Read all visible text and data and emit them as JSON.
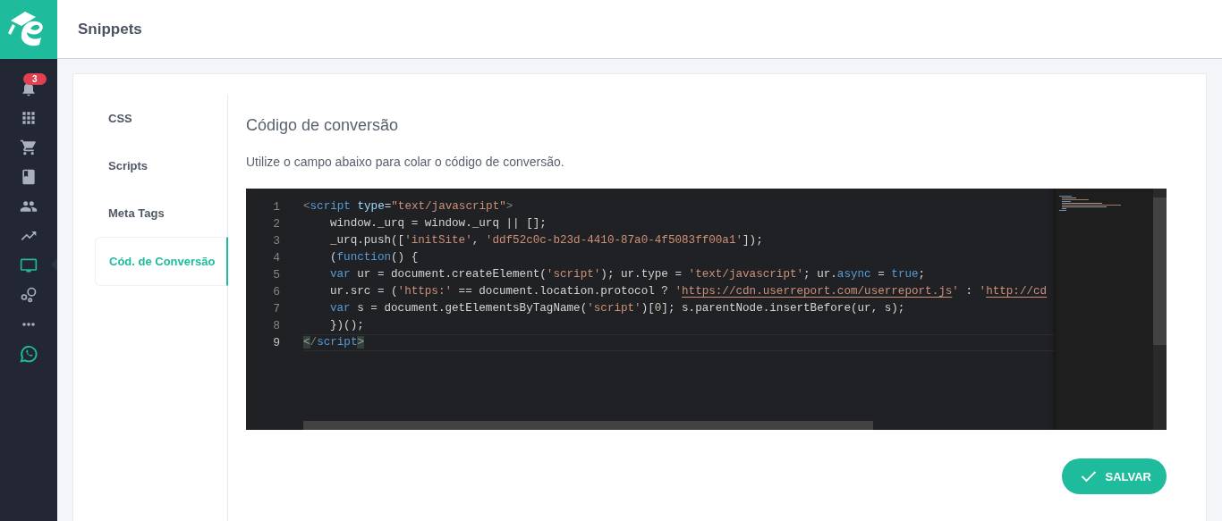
{
  "header": {
    "title": "Snippets"
  },
  "sidebar": {
    "items": [
      {
        "selected": false,
        "badge": "3"
      },
      {
        "selected": false
      },
      {
        "selected": false
      },
      {
        "selected": false
      },
      {
        "selected": false
      },
      {
        "selected": false
      },
      {
        "selected": true
      },
      {
        "selected": false
      },
      {
        "selected": false
      },
      {
        "selected": false
      }
    ]
  },
  "tabs": [
    {
      "label": "CSS",
      "selected": false
    },
    {
      "label": "Scripts",
      "selected": false
    },
    {
      "label": "Meta Tags",
      "selected": false
    },
    {
      "label": "Cód. de Conversão",
      "selected": true
    }
  ],
  "section": {
    "title": "Código de conversão",
    "description": "Utilize o campo abaixo para colar o código de conversão."
  },
  "editor": {
    "lines": [
      {
        "number": "1",
        "indented": false,
        "current": false,
        "tokens": [
          {
            "kind": "punct",
            "text": "<"
          },
          {
            "kind": "tag",
            "text": "script"
          },
          {
            "kind": "attr",
            "text": "type"
          },
          {
            "kind": "plain",
            "text": "="
          },
          {
            "kind": "str",
            "text": "\"text/javascript\""
          },
          {
            "kind": "punct",
            "text": ">"
          }
        ]
      },
      {
        "number": "2",
        "indented": true,
        "current": false,
        "tokens": [
          {
            "kind": "plain",
            "text": "window._urq = window._urq || [];"
          }
        ]
      },
      {
        "number": "3",
        "indented": true,
        "current": false,
        "tokens": [
          {
            "kind": "plain",
            "text": "_urq.push(["
          },
          {
            "kind": "str",
            "text": "'initSite'"
          },
          {
            "kind": "plain",
            "text": ", "
          },
          {
            "kind": "str",
            "text": "'ddf52c0c-b23d-4410-87a0-4f5083ff00a1'"
          },
          {
            "kind": "plain",
            "text": "]);"
          }
        ]
      },
      {
        "number": "4",
        "indented": true,
        "current": false,
        "tokens": [
          {
            "kind": "plain",
            "text": "("
          },
          {
            "kind": "kw",
            "text": "function"
          },
          {
            "kind": "plain",
            "text": "() {"
          }
        ]
      },
      {
        "number": "5",
        "indented": true,
        "current": false,
        "tokens": [
          {
            "kind": "kw",
            "text": "var"
          },
          {
            "kind": "plain",
            "text": " ur = document.createElement("
          },
          {
            "kind": "str",
            "text": "'script'"
          },
          {
            "kind": "plain",
            "text": "); ur.type = "
          },
          {
            "kind": "str",
            "text": "'text/javascript'"
          },
          {
            "kind": "plain",
            "text": "; ur."
          },
          {
            "kind": "kw",
            "text": "async"
          },
          {
            "kind": "plain",
            "text": " = "
          },
          {
            "kind": "kw",
            "text": "true"
          },
          {
            "kind": "plain",
            "text": ";"
          }
        ]
      },
      {
        "number": "6",
        "indented": true,
        "current": false,
        "tokens": [
          {
            "kind": "plain",
            "text": "ur.src = ("
          },
          {
            "kind": "str",
            "text": "'https:'"
          },
          {
            "kind": "plain",
            "text": " == document.location.protocol ? "
          },
          {
            "kind": "str",
            "text": "'"
          },
          {
            "kind": "link",
            "text": "https://cdn.userreport.com/userreport.js"
          },
          {
            "kind": "str",
            "text": "'"
          },
          {
            "kind": "plain",
            "text": " : "
          },
          {
            "kind": "str",
            "text": "'"
          },
          {
            "kind": "link",
            "text": "http://cd"
          }
        ]
      },
      {
        "number": "7",
        "indented": true,
        "current": false,
        "tokens": [
          {
            "kind": "kw",
            "text": "var"
          },
          {
            "kind": "plain",
            "text": " s = document.getElementsByTagName("
          },
          {
            "kind": "str",
            "text": "'script'"
          },
          {
            "kind": "plain",
            "text": ")["
          },
          {
            "kind": "num",
            "text": "0"
          },
          {
            "kind": "plain",
            "text": "]; s.parentNode.insertBefore(ur, s);"
          }
        ]
      },
      {
        "number": "8",
        "indented": true,
        "current": false,
        "tokens": [
          {
            "kind": "plain",
            "text": "})();"
          }
        ]
      },
      {
        "number": "9",
        "indented": false,
        "current": true,
        "tokens": [
          {
            "kind": "match",
            "text": "<"
          },
          {
            "kind": "punct",
            "text": "/"
          },
          {
            "kind": "tag",
            "text": "script"
          },
          {
            "kind": "match",
            "text": ">"
          }
        ]
      }
    ]
  },
  "save_button": {
    "label": "SALVAR"
  }
}
